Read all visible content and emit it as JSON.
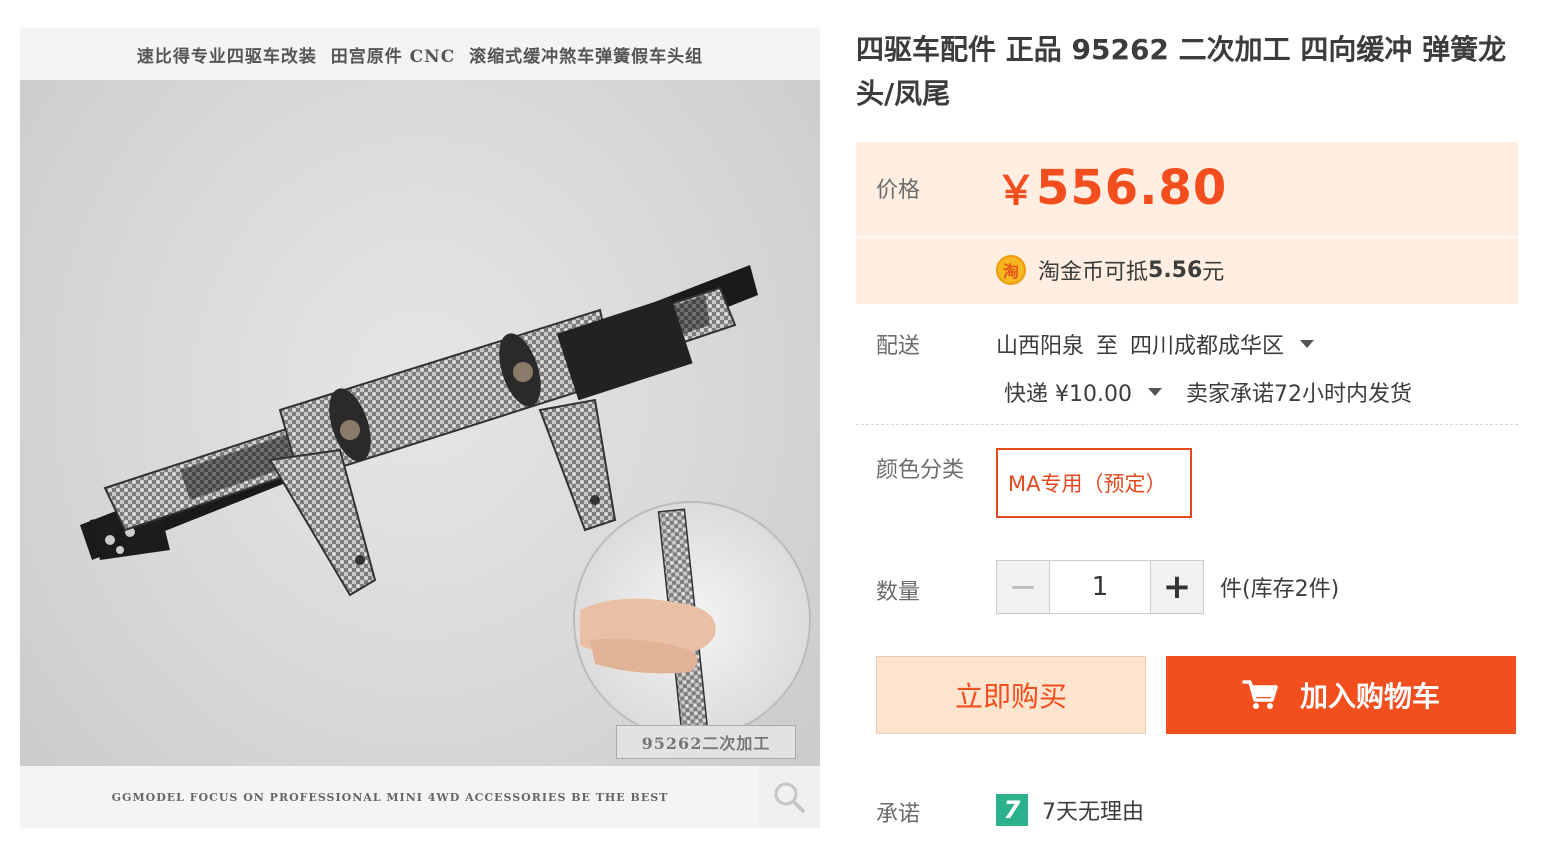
{
  "gallery": {
    "banner_top": "速比得专业四驱车改装  田宫原件 CNC  滚缩式缓冲煞车弹簧假车头组",
    "banner_bottom": "GGMODEL FOCUS ON PROFESSIONAL MINI 4WD ACCESSORIES BE THE BEST",
    "photo_label": "95262二次加工",
    "zoom_icon": "magnifier-icon"
  },
  "product": {
    "title": "四驱车配件 正品 95262 二次加工 四向缓冲 弹簧龙头/凤尾"
  },
  "price": {
    "label": "价格",
    "currency": "￥",
    "value": "556.80"
  },
  "coin": {
    "icon_text": "淘",
    "prefix": "淘金币可抵",
    "amount": "5.56",
    "suffix": "元"
  },
  "shipping": {
    "label": "配送",
    "from": "山西阳泉",
    "to_word": "至",
    "to": "四川成都成华区",
    "method": "快递 ¥10.00",
    "promise": "卖家承诺72小时内发货"
  },
  "sku": {
    "label": "颜色分类",
    "selected": "MA专用（预定）"
  },
  "quantity": {
    "label": "数量",
    "minus": "−",
    "value": "1",
    "plus": "+",
    "stock": "件(库存2件)"
  },
  "actions": {
    "buy_now": "立即购买",
    "add_to_cart": "加入购物车"
  },
  "promise": {
    "label": "承诺",
    "badge": "7",
    "text": "7天无理由"
  },
  "colors": {
    "accent": "#f24e1e",
    "price_bg": "#ffeee1",
    "buy_now_bg": "#ffe4d0"
  }
}
